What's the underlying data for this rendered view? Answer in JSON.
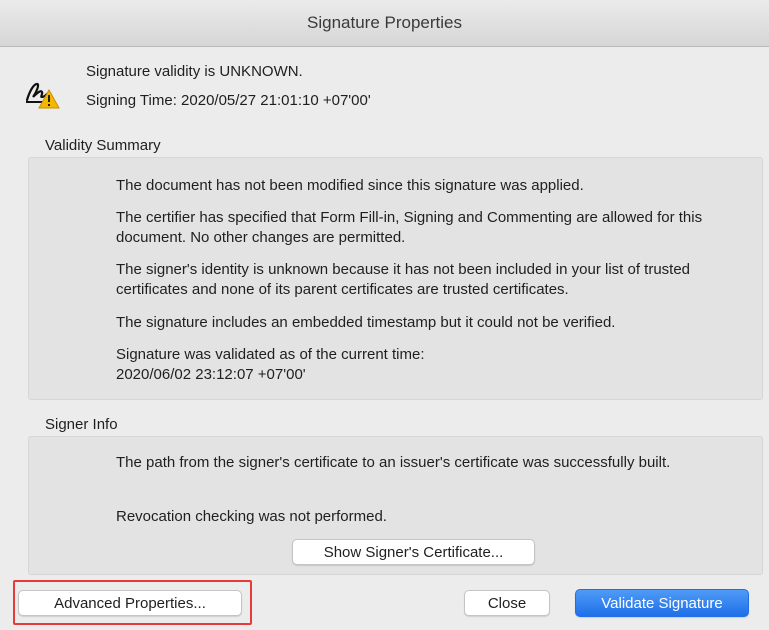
{
  "window": {
    "title": "Signature Properties"
  },
  "status": {
    "icon": "signature-warning-icon",
    "validity": "Signature validity is UNKNOWN.",
    "signing_time": "Signing Time:  2020/05/27 21:01:10 +07'00'"
  },
  "validity_summary": {
    "label": "Validity Summary",
    "items": [
      "The document has not been modified since this signature was applied.",
      "The certifier has specified that Form Fill-in, Signing and Commenting are allowed for this document. No other changes are permitted.",
      "The signer's identity is unknown because it has not been included in your list of trusted certificates and none of its parent certificates are trusted certificates.",
      "The signature includes an embedded timestamp but it could not be verified.",
      "Signature was validated as of the current time:\n2020/06/02 23:12:07 +07'00'"
    ]
  },
  "signer_info": {
    "label": "Signer Info",
    "items": [
      "The path from the signer's certificate to an issuer's certificate was successfully built.",
      "Revocation checking was not performed."
    ],
    "show_certificate_label": "Show Signer's Certificate..."
  },
  "buttons": {
    "advanced": "Advanced Properties...",
    "close": "Close",
    "validate": "Validate Signature"
  },
  "colors": {
    "accent": "#1f6fe8",
    "highlight": "#e53b3b",
    "warning": "#f5b800"
  }
}
